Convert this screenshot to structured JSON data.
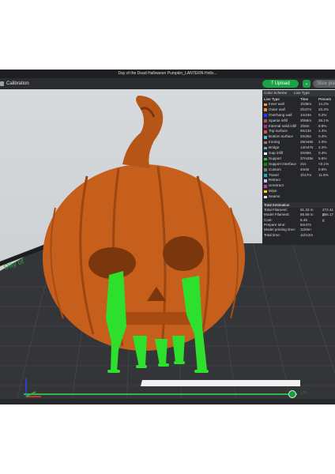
{
  "window": {
    "title": "Day of the Dead Halloween Pumpkin_LANTERN-Hollo..."
  },
  "toolbar": {
    "calibration_label": "Calibration",
    "upload_label": "Upload",
    "slice_label": "Slice plate"
  },
  "panel": {
    "color_scheme_label": "Color Scheme",
    "color_scheme_value": "Line Type",
    "columns": {
      "type": "Line Type",
      "time": "Time",
      "percent": "Percent"
    },
    "rows": [
      {
        "name": "Inner wall",
        "time": "1h36m",
        "percent": "14.2%",
        "color": "#e8a23c"
      },
      {
        "name": "Outer wall",
        "time": "2h37m",
        "percent": "23.3%",
        "color": "#ff7d38"
      },
      {
        "name": "Overhang wall",
        "time": "1m19s",
        "percent": "0.2%",
        "color": "#1e3cff"
      },
      {
        "name": "Sparse infill",
        "time": "2h56m",
        "percent": "26.1%",
        "color": "#a85068"
      },
      {
        "name": "Internal solid infill",
        "time": "1h6m",
        "percent": "9.8%",
        "color": "#b22e8e"
      },
      {
        "name": "Top surface",
        "time": "9m13s",
        "percent": "1.4%",
        "color": "#e84848"
      },
      {
        "name": "Bottom surface",
        "time": "2m25s",
        "percent": "0.4%",
        "color": "#54b8d6"
      },
      {
        "name": "Ironing",
        "time": "26m46s",
        "percent": "4.0%",
        "color": "#b87058"
      },
      {
        "name": "Bridge",
        "time": "14m47s",
        "percent": "2.2%",
        "color": "#5ca4b8"
      },
      {
        "name": "Gap infill",
        "time": "2m59s",
        "percent": "0.4%",
        "color": "#ffffff"
      },
      {
        "name": "Support",
        "time": "37m25s",
        "percent": "5.6%",
        "color": "#1fd11f"
      },
      {
        "name": "Support interface",
        "time": "21s",
        "percent": "<0.1%",
        "color": "#1c7d1c"
      },
      {
        "name": "Custom",
        "time": "4m0s",
        "percent": "0.9%",
        "color": "#5e8a5e"
      },
      {
        "name": "Travel",
        "time": "1h17m",
        "percent": "11.5%",
        "color": "#30a0c8"
      },
      {
        "name": "Retract",
        "time": "",
        "percent": "",
        "color": "#d0c0f0"
      },
      {
        "name": "Unretract",
        "time": "",
        "percent": "",
        "color": "#b040c0"
      },
      {
        "name": "Wipe",
        "time": "",
        "percent": "",
        "color": "#ffd700"
      },
      {
        "name": "Seams",
        "time": "",
        "percent": "",
        "color": "#e0e0e0"
      }
    ],
    "estimation": {
      "title": "Total Estimation",
      "items": [
        {
          "label": "Total Filament:",
          "value": "91.33 m",
          "value2": "272.41 g"
        },
        {
          "label": "Model Filament:",
          "value": "85.89 m",
          "value2": "256.17 g"
        },
        {
          "label": "Cost:",
          "value": "5.45",
          "value2": ""
        },
        {
          "label": "Prepare time:",
          "value": "5m47s",
          "value2": ""
        },
        {
          "label": "Model printing time:",
          "value": "11h6m",
          "value2": ""
        },
        {
          "label": "Total time:",
          "value": "11h12m",
          "value2": ""
        }
      ]
    }
  },
  "slider": {
    "value": "176",
    "fraction": 0.98
  },
  "colors": {
    "pumpkin": "#c9621e",
    "support": "#2ee02e",
    "plate": "#2f3033",
    "accent": "#18a444"
  }
}
